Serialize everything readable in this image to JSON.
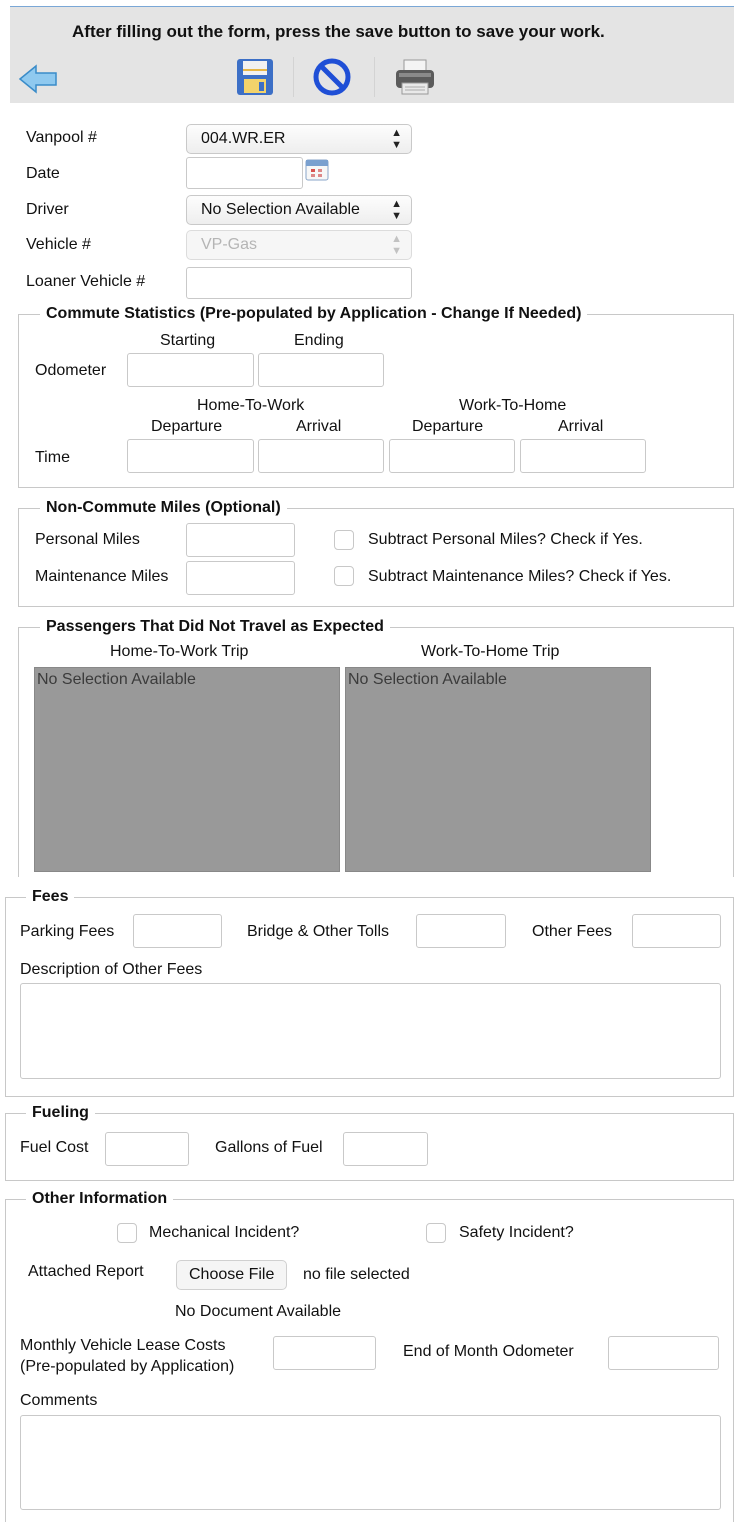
{
  "header": {
    "instruction": "After filling out the form, press the save button to save your work.",
    "back_icon": "back-arrow-icon",
    "save_icon": "floppy-disk-icon",
    "cancel_icon": "cancel-icon",
    "print_icon": "printer-icon"
  },
  "basic": {
    "vanpool_label": "Vanpool #",
    "vanpool_value": "004.WR.ER",
    "date_label": "Date",
    "date_value": "",
    "driver_label": "Driver",
    "driver_value": "No Selection Available",
    "vehicle_label": "Vehicle #",
    "vehicle_value": "VP-Gas",
    "loaner_label": "Loaner Vehicle #",
    "loaner_value": ""
  },
  "commute": {
    "legend": "Commute Statistics (Pre-populated by Application - Change If Needed)",
    "starting_label": "Starting",
    "ending_label": "Ending",
    "odometer_label": "Odometer",
    "home_to_work_label": "Home-To-Work",
    "work_to_home_label": "Work-To-Home",
    "departure_label": "Departure",
    "arrival_label": "Arrival",
    "time_label": "Time"
  },
  "noncommute": {
    "legend": "Non-Commute Miles (Optional)",
    "personal_label": "Personal Miles",
    "maintenance_label": "Maintenance Miles",
    "subtract_personal": "Subtract Personal Miles? Check if Yes.",
    "subtract_maintenance": "Subtract Maintenance Miles? Check if Yes."
  },
  "passengers": {
    "legend": "Passengers That Did Not Travel as Expected",
    "htw_trip_label": "Home-To-Work Trip",
    "wth_trip_label": "Work-To-Home Trip",
    "htw_placeholder": "No Selection Available",
    "wth_placeholder": "No Selection Available"
  },
  "fees": {
    "legend": "Fees",
    "parking_label": "Parking Fees",
    "tolls_label": "Bridge & Other Tolls",
    "other_label": "Other Fees",
    "description_label": "Description of Other Fees"
  },
  "fueling": {
    "legend": "Fueling",
    "fuel_cost_label": "Fuel Cost",
    "gallons_label": "Gallons of Fuel"
  },
  "other": {
    "legend": "Other Information",
    "mechanical_label": "Mechanical Incident?",
    "safety_label": "Safety Incident?",
    "attached_label": "Attached Report",
    "choose_file_label": "Choose File",
    "no_file_text": "no file selected",
    "no_document_text": "No Document Available",
    "lease_label_1": "Monthly Vehicle Lease Costs",
    "lease_label_2": "(Pre-populated by Application)",
    "eom_odometer_label": "End of Month Odometer",
    "comments_label": "Comments"
  }
}
